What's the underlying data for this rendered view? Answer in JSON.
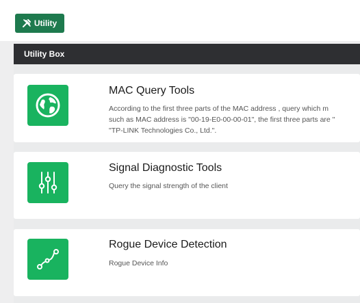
{
  "header": {
    "utility_button": "Utility"
  },
  "box": {
    "title": "Utility Box"
  },
  "tools": [
    {
      "title": "MAC Query Tools",
      "desc_lines": [
        "According to the first three parts of the MAC address , query which m",
        "such as MAC address is \"00-19-E0-00-00-01\", the first three parts are \"",
        "\"TP-LINK Technologies Co., Ltd.\"."
      ],
      "icon": "globe-icon"
    },
    {
      "title": "Signal Diagnostic Tools",
      "desc_lines": [
        "Query the signal strength of the client"
      ],
      "icon": "sliders-icon"
    },
    {
      "title": "Rogue Device Detection",
      "desc_lines": [
        "Rogue Device Info"
      ],
      "icon": "route-nodes-icon"
    }
  ],
  "colors": {
    "accent": "#19b35f",
    "button": "#1e7a4e",
    "header_bar": "#2e2f32"
  }
}
